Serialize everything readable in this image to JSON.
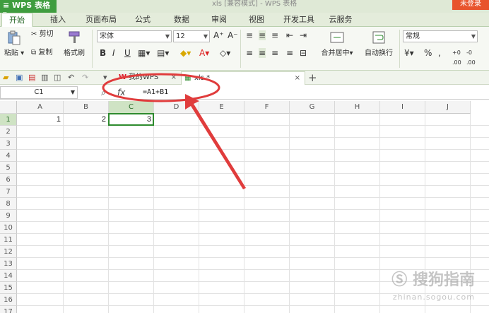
{
  "app": {
    "wps_button": "WPS 表格",
    "window_title": "xls [兼容模式] - WPS 表格",
    "login_button": "未登录"
  },
  "tabs": [
    "开始",
    "插入",
    "页面布局",
    "公式",
    "数据",
    "审阅",
    "视图",
    "开发工具",
    "云服务"
  ],
  "ribbon": {
    "paste": "粘贴",
    "cut": "剪切",
    "copy": "复制",
    "format_painter": "格式刷",
    "font_name": "宋体",
    "font_size": "12",
    "bold": "B",
    "italic": "I",
    "underline": "U",
    "grow_font": "A⁺",
    "shrink_font": "A⁻",
    "merge_center": "合并居中",
    "wrap_text": "自动换行",
    "number_format": "常规",
    "currency": "¥",
    "percent": "%",
    "comma": ","
  },
  "doc_tabs": [
    {
      "label": "我的WPS"
    },
    {
      "label": "xls *"
    }
  ],
  "formula_bar": {
    "cell_ref": "C1",
    "fx": "fx",
    "formula": "=A1+B1"
  },
  "sheet": {
    "columns": [
      "A",
      "B",
      "C",
      "D",
      "E",
      "F",
      "G",
      "H",
      "I",
      "J"
    ],
    "rows": [
      "1",
      "2",
      "3",
      "4",
      "5",
      "6",
      "7",
      "8",
      "9",
      "10",
      "11",
      "12",
      "13",
      "14",
      "15",
      "16",
      "17"
    ],
    "cells": {
      "A1": "1",
      "B1": "2",
      "C1": "3"
    },
    "selected_cell": "C1"
  },
  "watermark": {
    "brand": "搜狗指南",
    "url": "zhinan.sogou.com"
  },
  "colors": {
    "wps_green": "#3f9d3f",
    "selection_green": "#2e8b2e",
    "annotation_red": "#e03c3c"
  }
}
